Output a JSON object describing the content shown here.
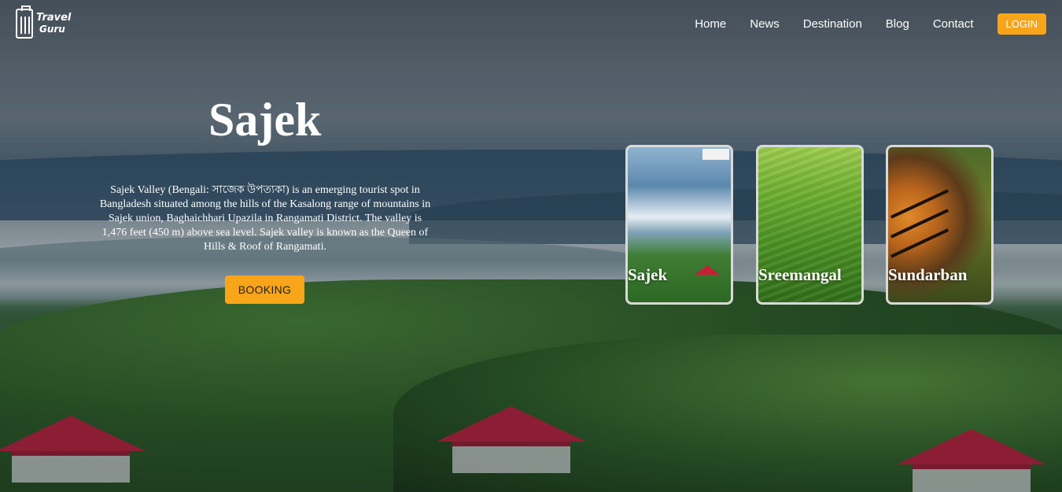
{
  "nav": {
    "logo_line1": "Travel",
    "logo_line2": "Guru",
    "links": [
      "Home",
      "News",
      "Destination",
      "Blog",
      "Contact"
    ],
    "login_label": "LOGIN"
  },
  "hero": {
    "title": "Sajek",
    "description": "Sajek Valley (Bengali: সাজেক উপত্যকা) is an emerging tourist spot in Bangladesh situated among the hills of the Kasalong range of mountains in Sajek union, Baghaichhari Upazila in Rangamati District. The valley is 1,476 feet (450 m) above sea level. Sajek valley is known as the Queen of Hills & Roof of Rangamati.",
    "booking_label": "BOOKING"
  },
  "cards": [
    {
      "label": "Sajek"
    },
    {
      "label": "Sreemangal"
    },
    {
      "label": "Sundarban"
    }
  ],
  "colors": {
    "accent": "#f9a51a",
    "text": "#ffffff"
  }
}
